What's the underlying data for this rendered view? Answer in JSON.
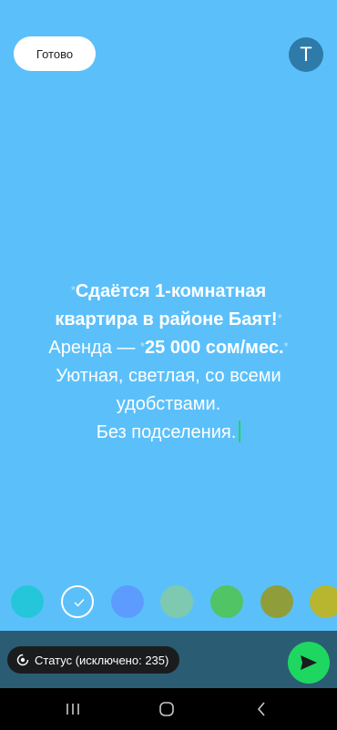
{
  "header": {
    "done_label": "Готово",
    "text_mode_label": "T"
  },
  "status_text": {
    "line1": "Сдаётся 1-комнатная",
    "line2": "квартира в районе Баят!",
    "line3_prefix": "Аренда — ",
    "line3_price": "25 000 сом/мес.",
    "line4": "Уютная, светлая, со всеми",
    "line5": "удобствами.",
    "line6": "Без подселения.",
    "asterisk": "*"
  },
  "palette": {
    "colors": [
      "#26c6da",
      "#5bc0fa",
      "#5c9cff",
      "#7ecab0",
      "#51c465",
      "#8f9e3a",
      "#b8b52e"
    ],
    "selected_index": 1
  },
  "footer": {
    "status_label": "Статус (исключено: 235)",
    "status_icon": "privacy-icon",
    "send_icon": "send-icon",
    "accent": "#1ed760"
  },
  "system_nav": {
    "recent_icon": "recent-apps-icon",
    "home_icon": "home-icon",
    "back_icon": "back-icon"
  }
}
